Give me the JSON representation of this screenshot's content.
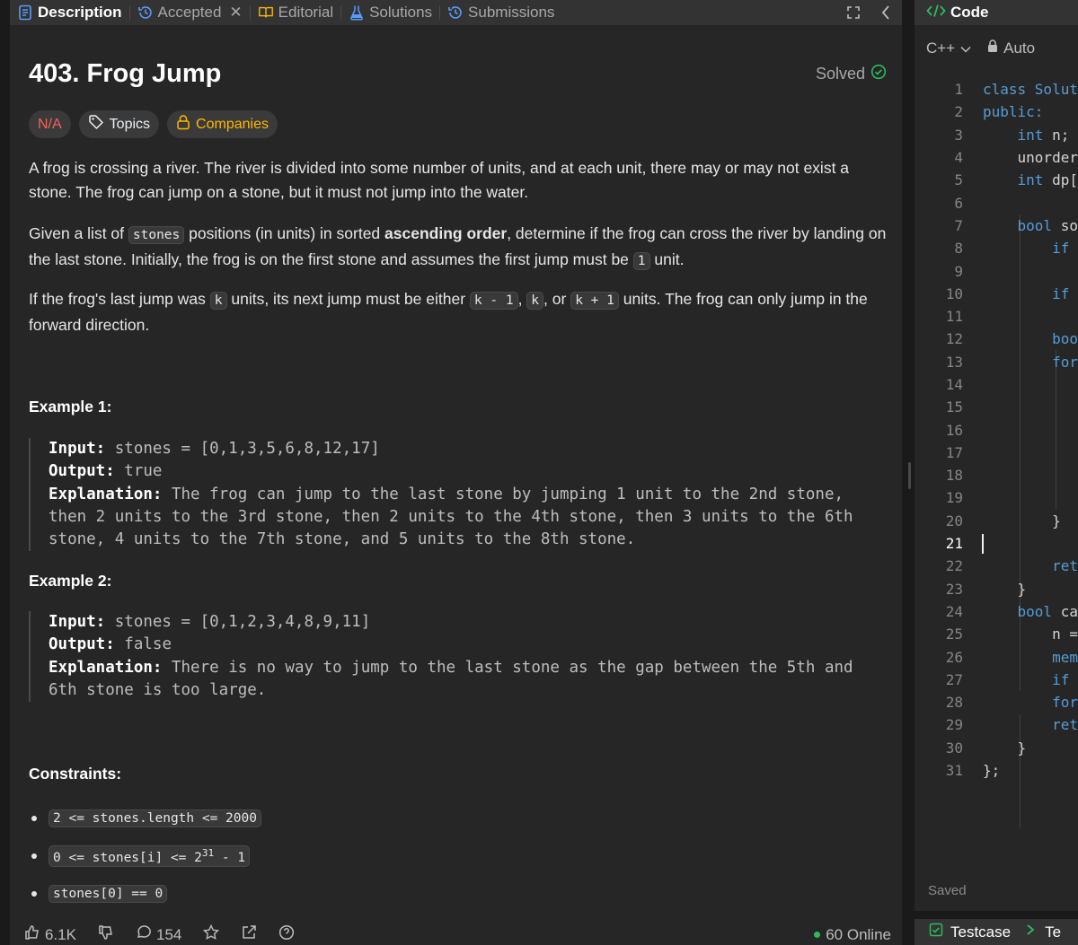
{
  "tabs": [
    {
      "label": "Description",
      "icon": "description-icon",
      "active": true
    },
    {
      "label": "Accepted",
      "icon": "history-icon"
    },
    {
      "label": "Editorial",
      "icon": "book-icon"
    },
    {
      "label": "Solutions",
      "icon": "flask-icon"
    },
    {
      "label": "Submissions",
      "icon": "history-icon"
    }
  ],
  "problem": {
    "title": "403. Frog Jump",
    "solved_label": "Solved",
    "chips": {
      "difficulty": "N/A",
      "topics": "Topics",
      "companies": "Companies"
    },
    "p1": "A frog is crossing a river. The river is divided into some number of units, and at each unit, there may or may not exist a stone. The frog can jump on a stone, but it must not jump into the water.",
    "p2": {
      "a": "Given a list of ",
      "code1": "stones",
      "b": " positions (in units) in sorted ",
      "bold": "ascending order",
      "c": ", determine if the frog can cross the river by landing on the last stone. Initially, the frog is on the first stone and assumes the first jump must be ",
      "code2": "1",
      "d": " unit."
    },
    "p3": {
      "a": "If the frog's last jump was ",
      "code1": "k",
      "b": " units, its next jump must be either ",
      "code2": "k - 1",
      "c": ", ",
      "code3": "k",
      "d": ", or ",
      "code4": "k + 1",
      "e": " units. The frog can only jump in the forward direction."
    },
    "examples": [
      {
        "heading": "Example 1:",
        "input_label": "Input:",
        "input": " stones = [0,1,3,5,6,8,12,17]",
        "output_label": "Output:",
        "output": " true",
        "explanation_label": "Explanation:",
        "explanation_l1": " The frog can jump to the last stone by jumping 1 unit to the 2nd stone,",
        "explanation_l2": "then 2 units to the 3rd stone, then 2 units to the 4th stone, then 3 units to the 6th",
        "explanation_l3": "stone, 4 units to the 7th stone, and 5 units to the 8th stone."
      },
      {
        "heading": "Example 2:",
        "input_label": "Input:",
        "input": " stones = [0,1,2,3,4,8,9,11]",
        "output_label": "Output:",
        "output": " false",
        "explanation_label": "Explanation:",
        "explanation_l1": " There is no way to jump to the last stone as the gap between the 5th and",
        "explanation_l2": "6th stone is too large."
      }
    ],
    "constraints_heading": "Constraints:",
    "constraints": {
      "c1": "2 <= stones.length <= 2000",
      "c2_a": "0 <= stones[i] <= 2",
      "c2_sup": "31",
      "c2_b": " - 1",
      "c3": "stones[0] == 0"
    }
  },
  "footer": {
    "likes": "6.1K",
    "comments": "154",
    "online": "60 Online"
  },
  "editor": {
    "header": "Code",
    "language": "C++",
    "mode": "Auto",
    "saved": "Saved",
    "current_line": 21,
    "lines": [
      {
        "n": "1",
        "t": "class Solut",
        "kw": true
      },
      {
        "n": "2",
        "t": "public:",
        "kw": true
      },
      {
        "n": "3",
        "t": "    int n;",
        "kwpart": "int"
      },
      {
        "n": "4",
        "t": "    unorder"
      },
      {
        "n": "5",
        "t": "    int dp[",
        "kwpart": "int"
      },
      {
        "n": "6",
        "t": ""
      },
      {
        "n": "7",
        "t": "    bool so",
        "kwpart": "bool"
      },
      {
        "n": "8",
        "t": "        if",
        "kwpart": "if"
      },
      {
        "n": "9",
        "t": ""
      },
      {
        "n": "10",
        "t": "        if",
        "kwpart": "if"
      },
      {
        "n": "11",
        "t": ""
      },
      {
        "n": "12",
        "t": "        boo",
        "kwpart": "boo"
      },
      {
        "n": "13",
        "t": "        for",
        "kwpart": "for"
      },
      {
        "n": "14",
        "t": ""
      },
      {
        "n": "15",
        "t": ""
      },
      {
        "n": "16",
        "t": ""
      },
      {
        "n": "17",
        "t": ""
      },
      {
        "n": "18",
        "t": ""
      },
      {
        "n": "19",
        "t": ""
      },
      {
        "n": "20",
        "t": "        }"
      },
      {
        "n": "21",
        "t": ""
      },
      {
        "n": "22",
        "t": "        ret",
        "kwpart": "ret"
      },
      {
        "n": "23",
        "t": "    }"
      },
      {
        "n": "24",
        "t": "    bool ca",
        "kwpart": "bool"
      },
      {
        "n": "25",
        "t": "        n ="
      },
      {
        "n": "26",
        "t": "        mem",
        "kwpart": "mem"
      },
      {
        "n": "27",
        "t": "        if",
        "kwpart": "if"
      },
      {
        "n": "28",
        "t": "        for",
        "kwpart": "for"
      },
      {
        "n": "29",
        "t": "        ret",
        "kwpart": "ret"
      },
      {
        "n": "30",
        "t": "    }"
      },
      {
        "n": "31",
        "t": "};"
      }
    ]
  },
  "testcase": {
    "label": "Testcase",
    "next": "Te"
  },
  "colors": {
    "accent_green": "#2cbb5d",
    "difficulty": "#f8615c",
    "companies": "#ffb800",
    "keyword": "#569cd6"
  }
}
